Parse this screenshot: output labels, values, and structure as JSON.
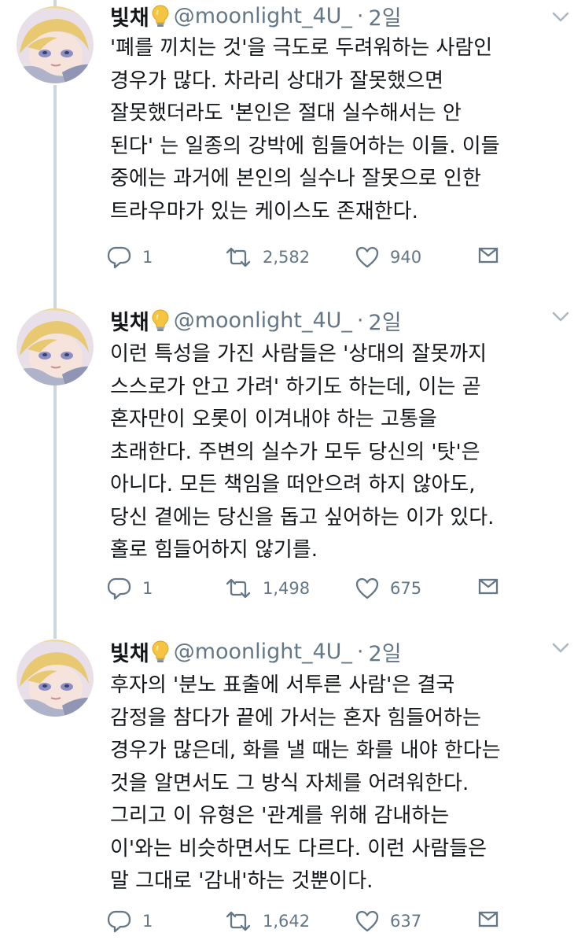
{
  "colors": {
    "text": "#14171a",
    "muted": "#657786",
    "thread_line": "#ccd6dd",
    "bulb": "#f5c542"
  },
  "icons": [
    "avatar",
    "lightbulb-icon",
    "chevron-down-icon",
    "reply-icon",
    "retweet-icon",
    "heart-icon",
    "mail-icon"
  ],
  "tweets": [
    {
      "author": "빛채",
      "handle": "@moonlight_4U_",
      "separator": "·",
      "time": "2일",
      "lines": [
        "'폐를 끼치는 것'을 극도로 두려워하는 사람인",
        "경우가 많다. 차라리 상대가 잘못했으면",
        "잘못했더라도 '본인은 절대 실수해서는 안",
        "된다' 는 일종의 강박에 힘들어하는 이들. 이들",
        "중에는 과거에 본인의 실수나 잘못으로 인한",
        "트라우마가 있는 케이스도 존재한다."
      ],
      "replies": "1",
      "retweets": "2,582",
      "likes": "940"
    },
    {
      "author": "빛채",
      "handle": "@moonlight_4U_",
      "separator": "·",
      "time": "2일",
      "lines": [
        "이런 특성을 가진 사람들은 '상대의 잘못까지",
        "스스로가 안고 가려' 하기도 하는데, 이는 곧",
        "혼자만이 오롯이 이겨내야 하는 고통을",
        "초래한다. 주변의 실수가 모두 당신의 '탓'은",
        "아니다. 모든 책임을 떠안으려 하지 않아도,",
        "당신 곁에는 당신을 돕고 싶어하는 이가 있다.",
        "홀로 힘들어하지 않기를."
      ],
      "replies": "1",
      "retweets": "1,498",
      "likes": "675"
    },
    {
      "author": "빛채",
      "handle": "@moonlight_4U_",
      "separator": "·",
      "time": "2일",
      "lines": [
        "후자의 '분노 표출에 서투른 사람'은 결국",
        "감정을 참다가 끝에 가서는 혼자 힘들어하는",
        "경우가 많은데, 화를 낼 때는 화를 내야 한다는",
        "것을 알면서도 그 방식 자체를 어려워한다.",
        "그리고 이 유형은 '관계를 위해 감내하는",
        "이'와는 비슷하면서도 다르다. 이런 사람들은",
        "말 그대로 '감내'하는 것뿐이다."
      ],
      "replies": "1",
      "retweets": "1,642",
      "likes": "637"
    }
  ]
}
